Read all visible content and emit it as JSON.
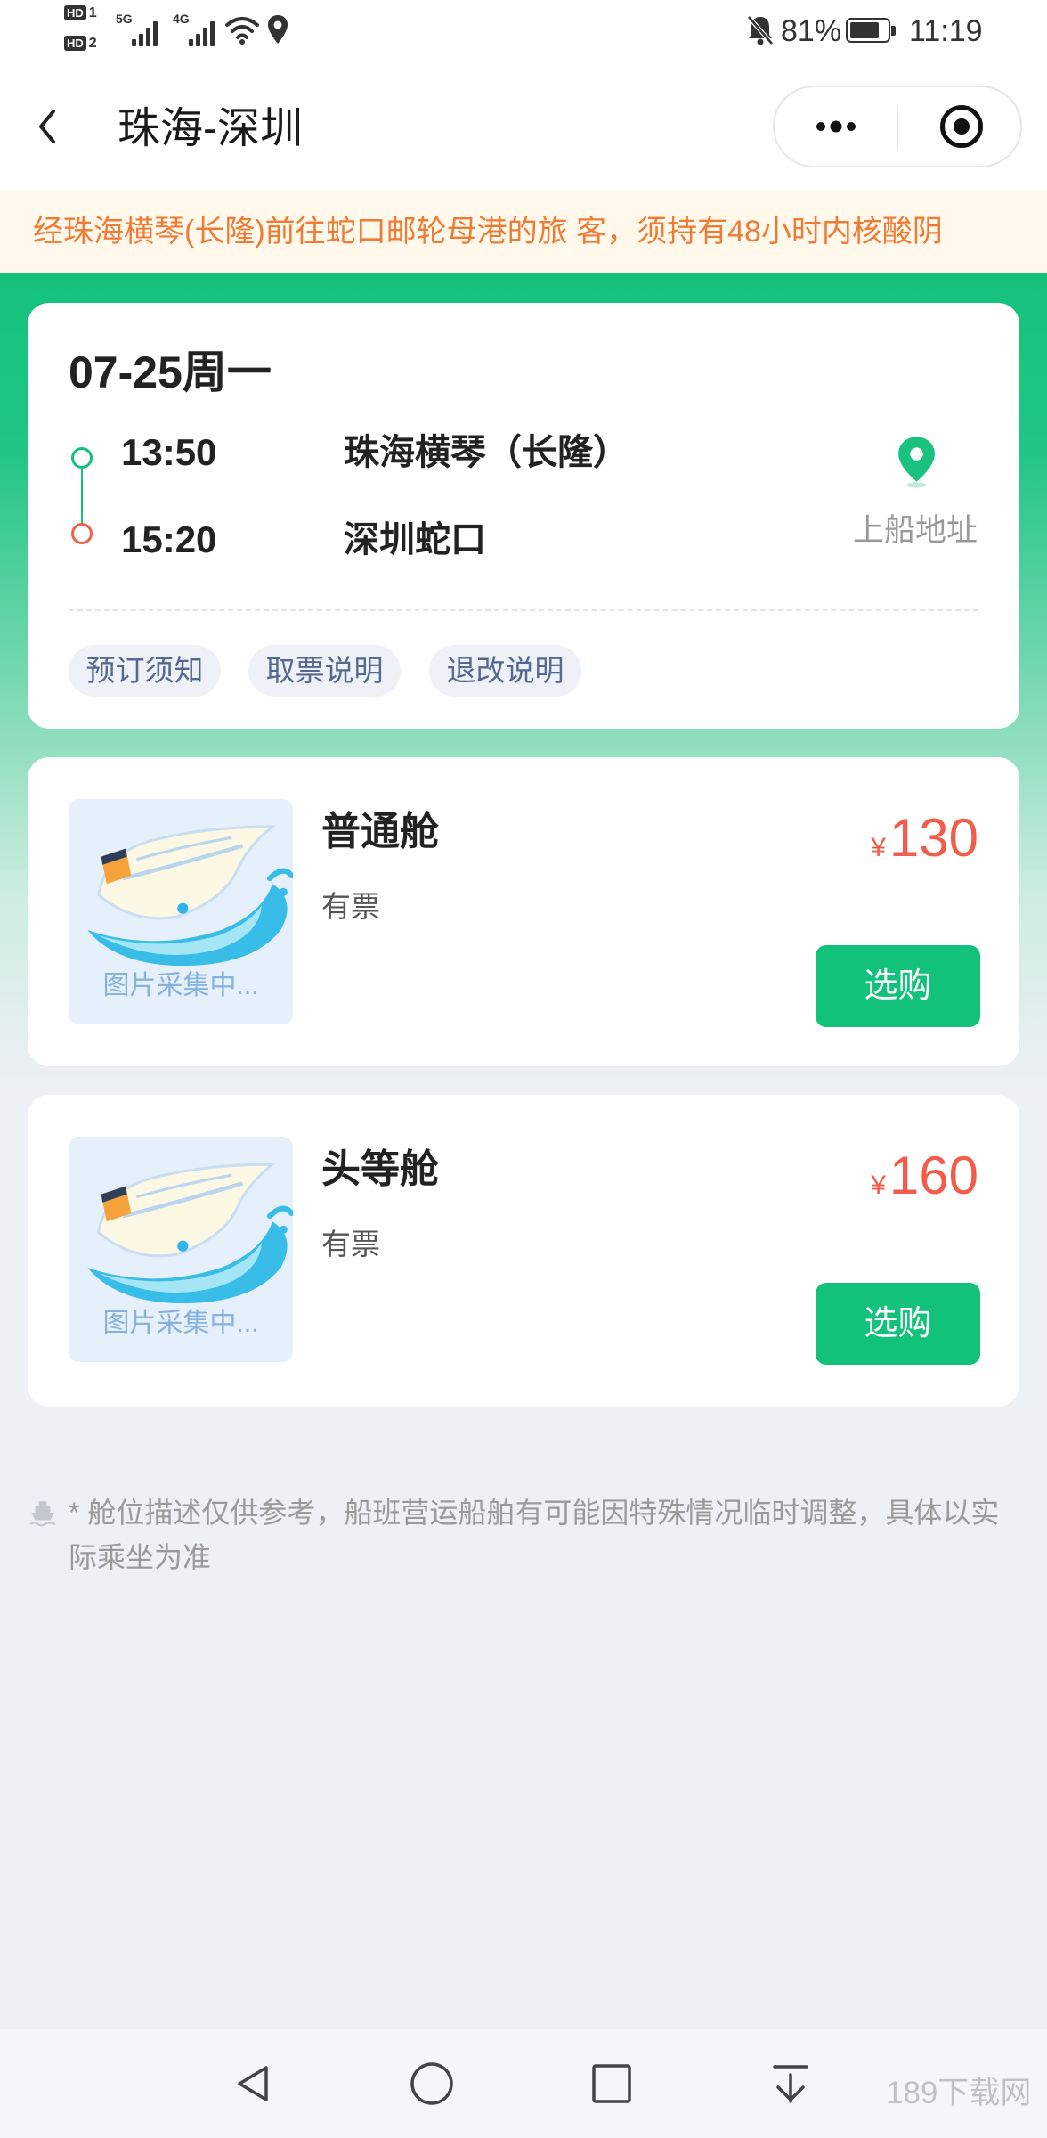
{
  "status_bar": {
    "sim1": {
      "badge": "HD",
      "slot": "1"
    },
    "sim2": {
      "badge": "HD",
      "slot": "2"
    },
    "network1": "5G",
    "network2": "4G",
    "battery": "81%",
    "time": "11:19",
    "icons": [
      "signal-icon",
      "wifi-icon",
      "location-icon",
      "bell-off-icon",
      "battery-icon"
    ]
  },
  "nav": {
    "title": "珠海-深圳",
    "back_icon": "back-chevron-icon",
    "more_icon": "more-dots-icon",
    "close_icon": "target-icon"
  },
  "notice": {
    "text": "经珠海横琴(长隆)前往蛇口邮轮母港的旅 客，须持有48小时内核酸阴"
  },
  "trip": {
    "date": "07-25周一",
    "departure": {
      "time": "13:50",
      "port": "珠海横琴（长隆）"
    },
    "arrival": {
      "time": "15:20",
      "port": "深圳蛇口"
    },
    "boarding_address": {
      "label": "上船地址",
      "icon": "location-pin-icon"
    },
    "tags": [
      "预订须知",
      "取票说明",
      "退改说明"
    ]
  },
  "cabins": [
    {
      "name": "普通舱",
      "availability": "有票",
      "currency": "¥",
      "price": "130",
      "image_placeholder": "图片采集中...",
      "button": "选购"
    },
    {
      "name": "头等舱",
      "availability": "有票",
      "currency": "¥",
      "price": "160",
      "image_placeholder": "图片采集中...",
      "button": "选购"
    }
  ],
  "footnote": {
    "icon": "ship-icon",
    "text": "* 舱位描述仅供参考，船班营运船舶有可能因特殊情况临时调整，具体以实际乘坐为准"
  },
  "system_nav": {
    "icons": [
      "back-triangle-icon",
      "home-circle-icon",
      "recents-square-icon",
      "pull-down-icon"
    ]
  },
  "watermark": "189下载网",
  "colors": {
    "brand_green": "#12c27b",
    "price_red": "#f25c4a",
    "notice_orange": "#ef7b34",
    "notice_bg": "#fff8eb",
    "page_bg": "#edf0f4"
  }
}
